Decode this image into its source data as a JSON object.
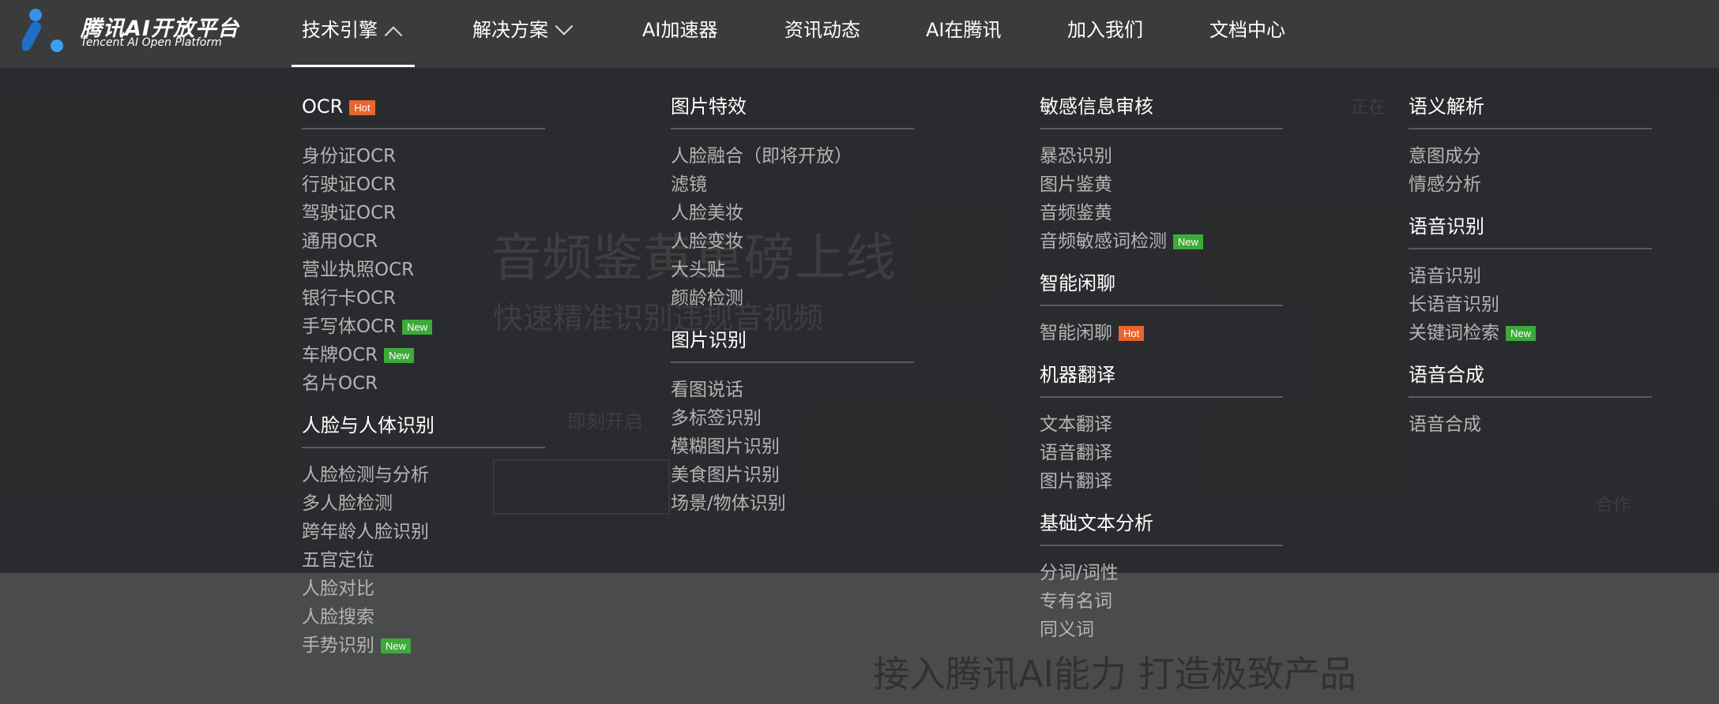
{
  "logo": {
    "cn": "腾讯AI开放平台",
    "en": "Tencent AI Open Platform"
  },
  "nav": [
    {
      "label": "技术引擎",
      "chevron": "up",
      "active": true
    },
    {
      "label": "解决方案",
      "chevron": "down"
    },
    {
      "label": "AI加速器"
    },
    {
      "label": "资讯动态"
    },
    {
      "label": "AI在腾讯"
    },
    {
      "label": "加入我们"
    },
    {
      "label": "文档中心"
    }
  ],
  "background": {
    "headline": "音频鉴黄重磅上线",
    "subline": "快速精准识别违规音视频",
    "button": "即刻开启",
    "bottom": "接入腾讯AI能力 打造极致产品",
    "right_tag_1": "正在",
    "right_tag_2": "合作"
  },
  "colors": {
    "hot": "#e8662d",
    "new": "#3daa3a"
  },
  "menu": {
    "col1": [
      {
        "title": "OCR",
        "badge": "Hot",
        "items": [
          {
            "label": "身份证OCR"
          },
          {
            "label": "行驶证OCR"
          },
          {
            "label": "驾驶证OCR"
          },
          {
            "label": "通用OCR"
          },
          {
            "label": "营业执照OCR"
          },
          {
            "label": "银行卡OCR"
          },
          {
            "label": "手写体OCR",
            "badge": "New"
          },
          {
            "label": "车牌OCR",
            "badge": "New"
          },
          {
            "label": "名片OCR"
          }
        ]
      },
      {
        "title": "人脸与人体识别",
        "items": [
          {
            "label": "人脸检测与分析"
          },
          {
            "label": "多人脸检测"
          },
          {
            "label": "跨年龄人脸识别"
          },
          {
            "label": "五官定位"
          },
          {
            "label": "人脸对比"
          },
          {
            "label": "人脸搜索"
          },
          {
            "label": "手势识别",
            "badge": "New"
          }
        ]
      }
    ],
    "col2": [
      {
        "title": "图片特效",
        "items": [
          {
            "label": "人脸融合（即将开放）"
          },
          {
            "label": "滤镜"
          },
          {
            "label": "人脸美妆"
          },
          {
            "label": "人脸变妆"
          },
          {
            "label": "大头贴"
          },
          {
            "label": "颜龄检测"
          }
        ]
      },
      {
        "title": "图片识别",
        "items": [
          {
            "label": "看图说话"
          },
          {
            "label": "多标签识别"
          },
          {
            "label": "模糊图片识别"
          },
          {
            "label": "美食图片识别"
          },
          {
            "label": "场景/物体识别"
          }
        ]
      }
    ],
    "col3": [
      {
        "title": "敏感信息审核",
        "items": [
          {
            "label": "暴恐识别"
          },
          {
            "label": "图片鉴黄"
          },
          {
            "label": "音频鉴黄"
          },
          {
            "label": "音频敏感词检测",
            "badge": "New"
          }
        ]
      },
      {
        "title": "智能闲聊",
        "items": [
          {
            "label": "智能闲聊",
            "badge": "Hot"
          }
        ]
      },
      {
        "title": "机器翻译",
        "items": [
          {
            "label": "文本翻译"
          },
          {
            "label": "语音翻译"
          },
          {
            "label": "图片翻译"
          }
        ]
      },
      {
        "title": "基础文本分析",
        "items": [
          {
            "label": "分词/词性"
          },
          {
            "label": "专有名词"
          },
          {
            "label": "同义词"
          }
        ]
      }
    ],
    "col4": [
      {
        "title": "语义解析",
        "items": [
          {
            "label": "意图成分"
          },
          {
            "label": "情感分析"
          }
        ]
      },
      {
        "title": "语音识别",
        "items": [
          {
            "label": "语音识别"
          },
          {
            "label": "长语音识别"
          },
          {
            "label": "关键词检索",
            "badge": "New"
          }
        ]
      },
      {
        "title": "语音合成",
        "items": [
          {
            "label": "语音合成"
          }
        ]
      }
    ]
  }
}
